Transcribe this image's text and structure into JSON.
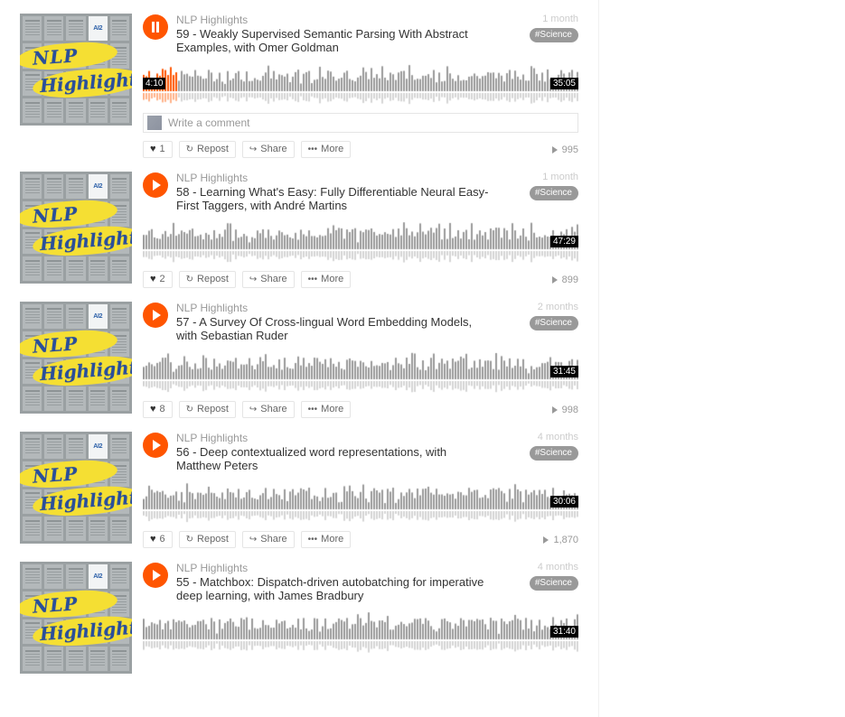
{
  "app": {
    "artwork_title_line1": "NLP",
    "artwork_title_line2": "Highlights",
    "artwork_logo": "AI2",
    "accent_color": "#ff5500",
    "tag_color": "#999999"
  },
  "comment": {
    "placeholder": "Write a comment"
  },
  "actions": {
    "repost_label": "Repost",
    "share_label": "Share",
    "more_label": "More",
    "heart_glyph": "♥",
    "repost_glyph": "↻",
    "share_glyph": "↪",
    "more_glyph": "•••"
  },
  "tracks": [
    {
      "artist": "NLP Highlights",
      "title": "59 - Weakly Supervised Semantic Parsing With Abstract Examples, with Omer Goldman",
      "when": "1 month",
      "tag": "#Science",
      "playing": true,
      "elapsed": "4:10",
      "duration": "35:05",
      "progress_percent": 8,
      "likes": "1",
      "plays": "995",
      "has_comment_box": true
    },
    {
      "artist": "NLP Highlights",
      "title": "58 - Learning What's Easy: Fully Differentiable Neural Easy-First Taggers, with André Martins",
      "when": "1 month",
      "tag": "#Science",
      "playing": false,
      "elapsed": "",
      "duration": "47:29",
      "progress_percent": 0,
      "likes": "2",
      "plays": "899",
      "has_comment_box": false
    },
    {
      "artist": "NLP Highlights",
      "title": "57 - A Survey Of Cross-lingual Word Embedding Models, with Sebastian Ruder",
      "when": "2 months",
      "tag": "#Science",
      "playing": false,
      "elapsed": "",
      "duration": "31:45",
      "progress_percent": 0,
      "likes": "8",
      "plays": "998",
      "has_comment_box": false
    },
    {
      "artist": "NLP Highlights",
      "title": "56 - Deep contextualized word representations, with Matthew Peters",
      "when": "4 months",
      "tag": "#Science",
      "playing": false,
      "elapsed": "",
      "duration": "30:06",
      "progress_percent": 0,
      "likes": "6",
      "plays": "1,870",
      "has_comment_box": false
    },
    {
      "artist": "NLP Highlights",
      "title": "55 - Matchbox: Dispatch-driven autobatching for imperative deep learning, with James Bradbury",
      "when": "4 months",
      "tag": "#Science",
      "playing": false,
      "elapsed": "",
      "duration": "31:40",
      "progress_percent": 0,
      "likes": "",
      "plays": "",
      "has_comment_box": false
    }
  ]
}
